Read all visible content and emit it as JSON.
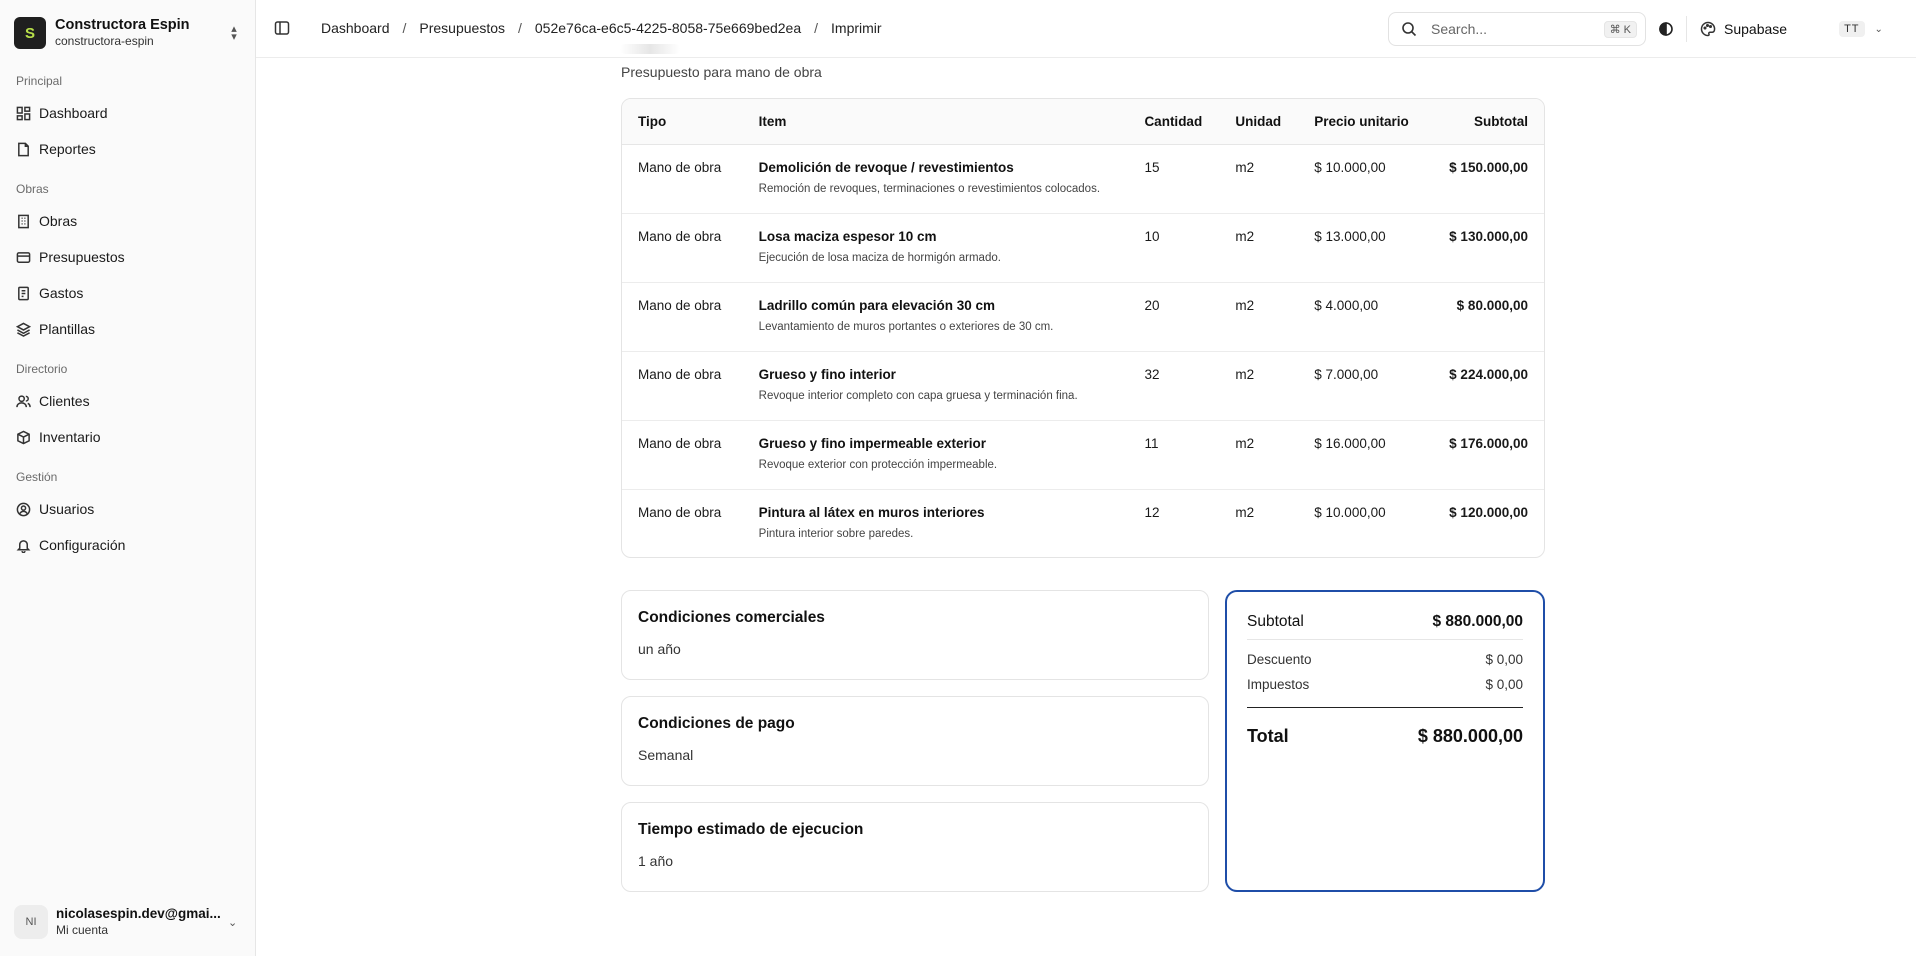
{
  "sidebar": {
    "org_logo_text": "S",
    "org_name": "Constructora Espin",
    "org_slug": "constructora-espin",
    "sections": [
      {
        "label": "Principal",
        "items": [
          {
            "label": "Dashboard",
            "icon": "dashboard-icon"
          },
          {
            "label": "Reportes",
            "icon": "file-icon"
          }
        ]
      },
      {
        "label": "Obras",
        "items": [
          {
            "label": "Obras",
            "icon": "building-icon"
          },
          {
            "label": "Presupuestos",
            "icon": "wallet-icon"
          },
          {
            "label": "Gastos",
            "icon": "receipt-icon"
          },
          {
            "label": "Plantillas",
            "icon": "layers-icon"
          }
        ]
      },
      {
        "label": "Directorio",
        "items": [
          {
            "label": "Clientes",
            "icon": "users-icon"
          },
          {
            "label": "Inventario",
            "icon": "box-icon"
          }
        ]
      },
      {
        "label": "Gestión",
        "items": [
          {
            "label": "Usuarios",
            "icon": "user-circle-icon"
          },
          {
            "label": "Configuración",
            "icon": "bell-icon"
          }
        ]
      }
    ],
    "user": {
      "initials": "NI",
      "email": "nicolasespin.dev@gmai...",
      "subtitle": "Mi cuenta"
    }
  },
  "header": {
    "breadcrumb": [
      "Dashboard",
      "Presupuestos",
      "052e76ca-e6c5-4225-8058-75e669bed2ea",
      "Imprimir"
    ],
    "search_placeholder": "Search...",
    "search_shortcut": "⌘ K",
    "workspace": "Supabase",
    "workspace_badge": "TT"
  },
  "main": {
    "caption": "Presupuesto para mano de obra",
    "table": {
      "columns": [
        "Tipo",
        "Item",
        "Cantidad",
        "Unidad",
        "Precio unitario",
        "Subtotal"
      ],
      "rows": [
        {
          "tipo": "Mano de obra",
          "item": "Demolición de revoque / revestimientos",
          "desc": "Remoción de revoques, terminaciones o revestimientos colocados.",
          "cantidad": "15",
          "unidad": "m2",
          "precio": "$ 10.000,00",
          "subtotal": "$ 150.000,00"
        },
        {
          "tipo": "Mano de obra",
          "item": "Losa maciza espesor 10 cm",
          "desc": "Ejecución de losa maciza de hormigón armado.",
          "cantidad": "10",
          "unidad": "m2",
          "precio": "$ 13.000,00",
          "subtotal": "$ 130.000,00"
        },
        {
          "tipo": "Mano de obra",
          "item": "Ladrillo común para elevación 30 cm",
          "desc": "Levantamiento de muros portantes o exteriores de 30 cm.",
          "cantidad": "20",
          "unidad": "m2",
          "precio": "$ 4.000,00",
          "subtotal": "$ 80.000,00"
        },
        {
          "tipo": "Mano de obra",
          "item": "Grueso y fino interior",
          "desc": "Revoque interior completo con capa gruesa y terminación fina.",
          "cantidad": "32",
          "unidad": "m2",
          "precio": "$ 7.000,00",
          "subtotal": "$ 224.000,00"
        },
        {
          "tipo": "Mano de obra",
          "item": "Grueso y fino impermeable exterior",
          "desc": "Revoque exterior con protección impermeable.",
          "cantidad": "11",
          "unidad": "m2",
          "precio": "$ 16.000,00",
          "subtotal": "$ 176.000,00"
        },
        {
          "tipo": "Mano de obra",
          "item": "Pintura al látex en muros interiores",
          "desc": "Pintura interior sobre paredes.",
          "cantidad": "12",
          "unidad": "m2",
          "precio": "$ 10.000,00",
          "subtotal": "$ 120.000,00"
        }
      ]
    },
    "conditions": [
      {
        "title": "Condiciones comerciales",
        "value": "un año"
      },
      {
        "title": "Condiciones de pago",
        "value": "Semanal"
      },
      {
        "title": "Tiempo estimado de ejecucion",
        "value": "1 año"
      }
    ],
    "totals": {
      "subtotal_label": "Subtotal",
      "subtotal": "$ 880.000,00",
      "descuento_label": "Descuento",
      "descuento": "$ 0,00",
      "impuestos_label": "Impuestos",
      "impuestos": "$ 0,00",
      "total_label": "Total",
      "total": "$ 880.000,00"
    },
    "accent_color": "#1f4ea8"
  }
}
